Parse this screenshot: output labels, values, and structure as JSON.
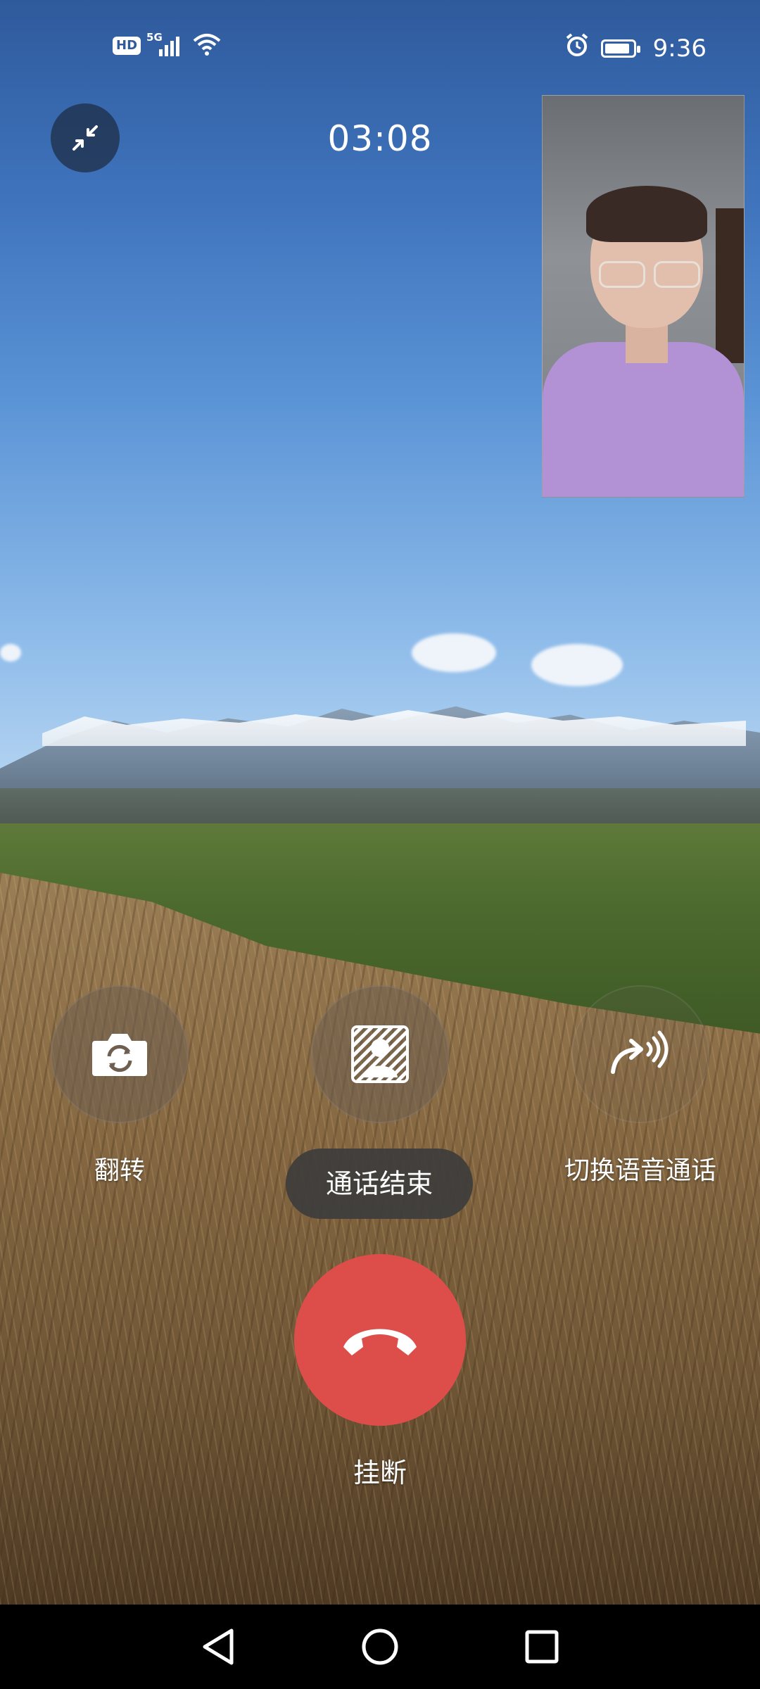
{
  "status_bar": {
    "hd": "HD",
    "network": "5G",
    "time": "9:36",
    "icons": [
      "hd-icon",
      "signal-icon",
      "wifi-icon",
      "alarm-icon",
      "battery-icon"
    ]
  },
  "call": {
    "timer": "03:08",
    "toast": "通话结束"
  },
  "actions": {
    "flip_label": "翻转",
    "switch_voice_label": "切换语音通话",
    "hangup_label": "挂断"
  },
  "colors": {
    "hangup": "#dd4e4b",
    "toast_bg": "#3c3c3c"
  }
}
